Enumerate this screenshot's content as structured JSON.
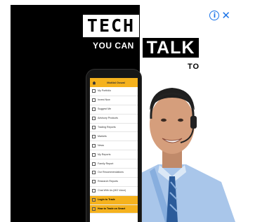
{
  "ad": {
    "headline": {
      "line1": "TECH",
      "line2": "YOU CAN",
      "line3": "TALK",
      "line4": "TO"
    },
    "controls": {
      "info": "i",
      "close": "✕"
    },
    "colors": {
      "accent": "#f5b21e",
      "dark": "#000000",
      "ad_control": "#1a73e8"
    }
  },
  "phone": {
    "app_title": "Motilal Oswal",
    "menu": [
      {
        "label": "My Portfolio",
        "icon": "portfolio-icon"
      },
      {
        "label": "Invest Now",
        "icon": "invest-icon"
      },
      {
        "label": "Suggest Me",
        "icon": "bulb-icon"
      },
      {
        "label": "Advisory Products",
        "icon": "advisory-icon"
      },
      {
        "label": "Trading Reports",
        "icon": "chart-icon"
      },
      {
        "label": "Markets",
        "icon": "markets-icon"
      },
      {
        "label": "News",
        "icon": "news-icon"
      },
      {
        "label": "My Reports",
        "icon": "reports-icon"
      },
      {
        "label": "Family Report",
        "icon": "family-icon"
      },
      {
        "label": "Our Recommendations",
        "icon": "recommendation-icon"
      },
      {
        "label": "Research Reports",
        "icon": "research-icon"
      },
      {
        "label": "Chat With Us (MO Voice)",
        "icon": "chat-icon"
      },
      {
        "label": "Login to Trade",
        "icon": "login-icon",
        "highlight": true
      },
      {
        "label": "How to Trade on Smart",
        "icon": "help-icon",
        "highlight": true
      }
    ]
  }
}
